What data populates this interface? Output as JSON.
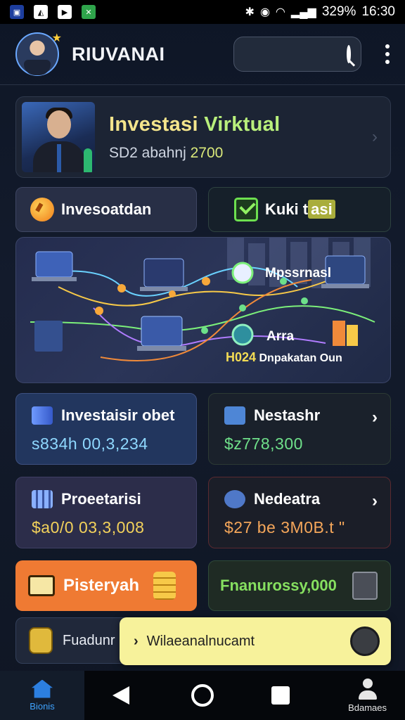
{
  "status_bar": {
    "right_text": "329%",
    "time": "16:30",
    "colors": {
      "bg": "#000000"
    }
  },
  "header": {
    "username": "RIUVANAI",
    "search": {
      "placeholder": ""
    }
  },
  "profile_card": {
    "title_a": "Investasi ",
    "title_b": "Virktual",
    "subtitle_a": "SD2 abahnj ",
    "subtitle_b": "2700"
  },
  "pills": {
    "left": "Invesoatdan",
    "right_a": "Kuki t",
    "right_b": "asi"
  },
  "hero": {
    "label_1": "Mpssrnasl",
    "label_2": "Arra",
    "label_3_a": "H024",
    "label_3_b": "Dnpakatan Oun"
  },
  "cards": [
    {
      "title": "Investaisir obet",
      "value": "s834h 00,3,234",
      "value_color": "#8fd8ff",
      "chevron": false
    },
    {
      "title": "Nestashr",
      "value": "$z778,300",
      "value_color": "#6fe08a",
      "chevron": true
    },
    {
      "title": "Proeetarisi",
      "value": "$a0/0 03,3,008",
      "value_color": "#f3d25b",
      "chevron": false
    },
    {
      "title": "Nedeatra",
      "value": "$27 be 3M0B.t \"",
      "value_color": "#f4a65a",
      "chevron": true
    }
  ],
  "bottom_cards": {
    "left": "Pisteryah",
    "right": "Fnanurossy,000",
    "small_left": "Fuadunr",
    "toast": "Wilaeanalnucamt"
  },
  "navbar": {
    "home_label": "Bionis",
    "profile_label": "Bdamaes"
  }
}
